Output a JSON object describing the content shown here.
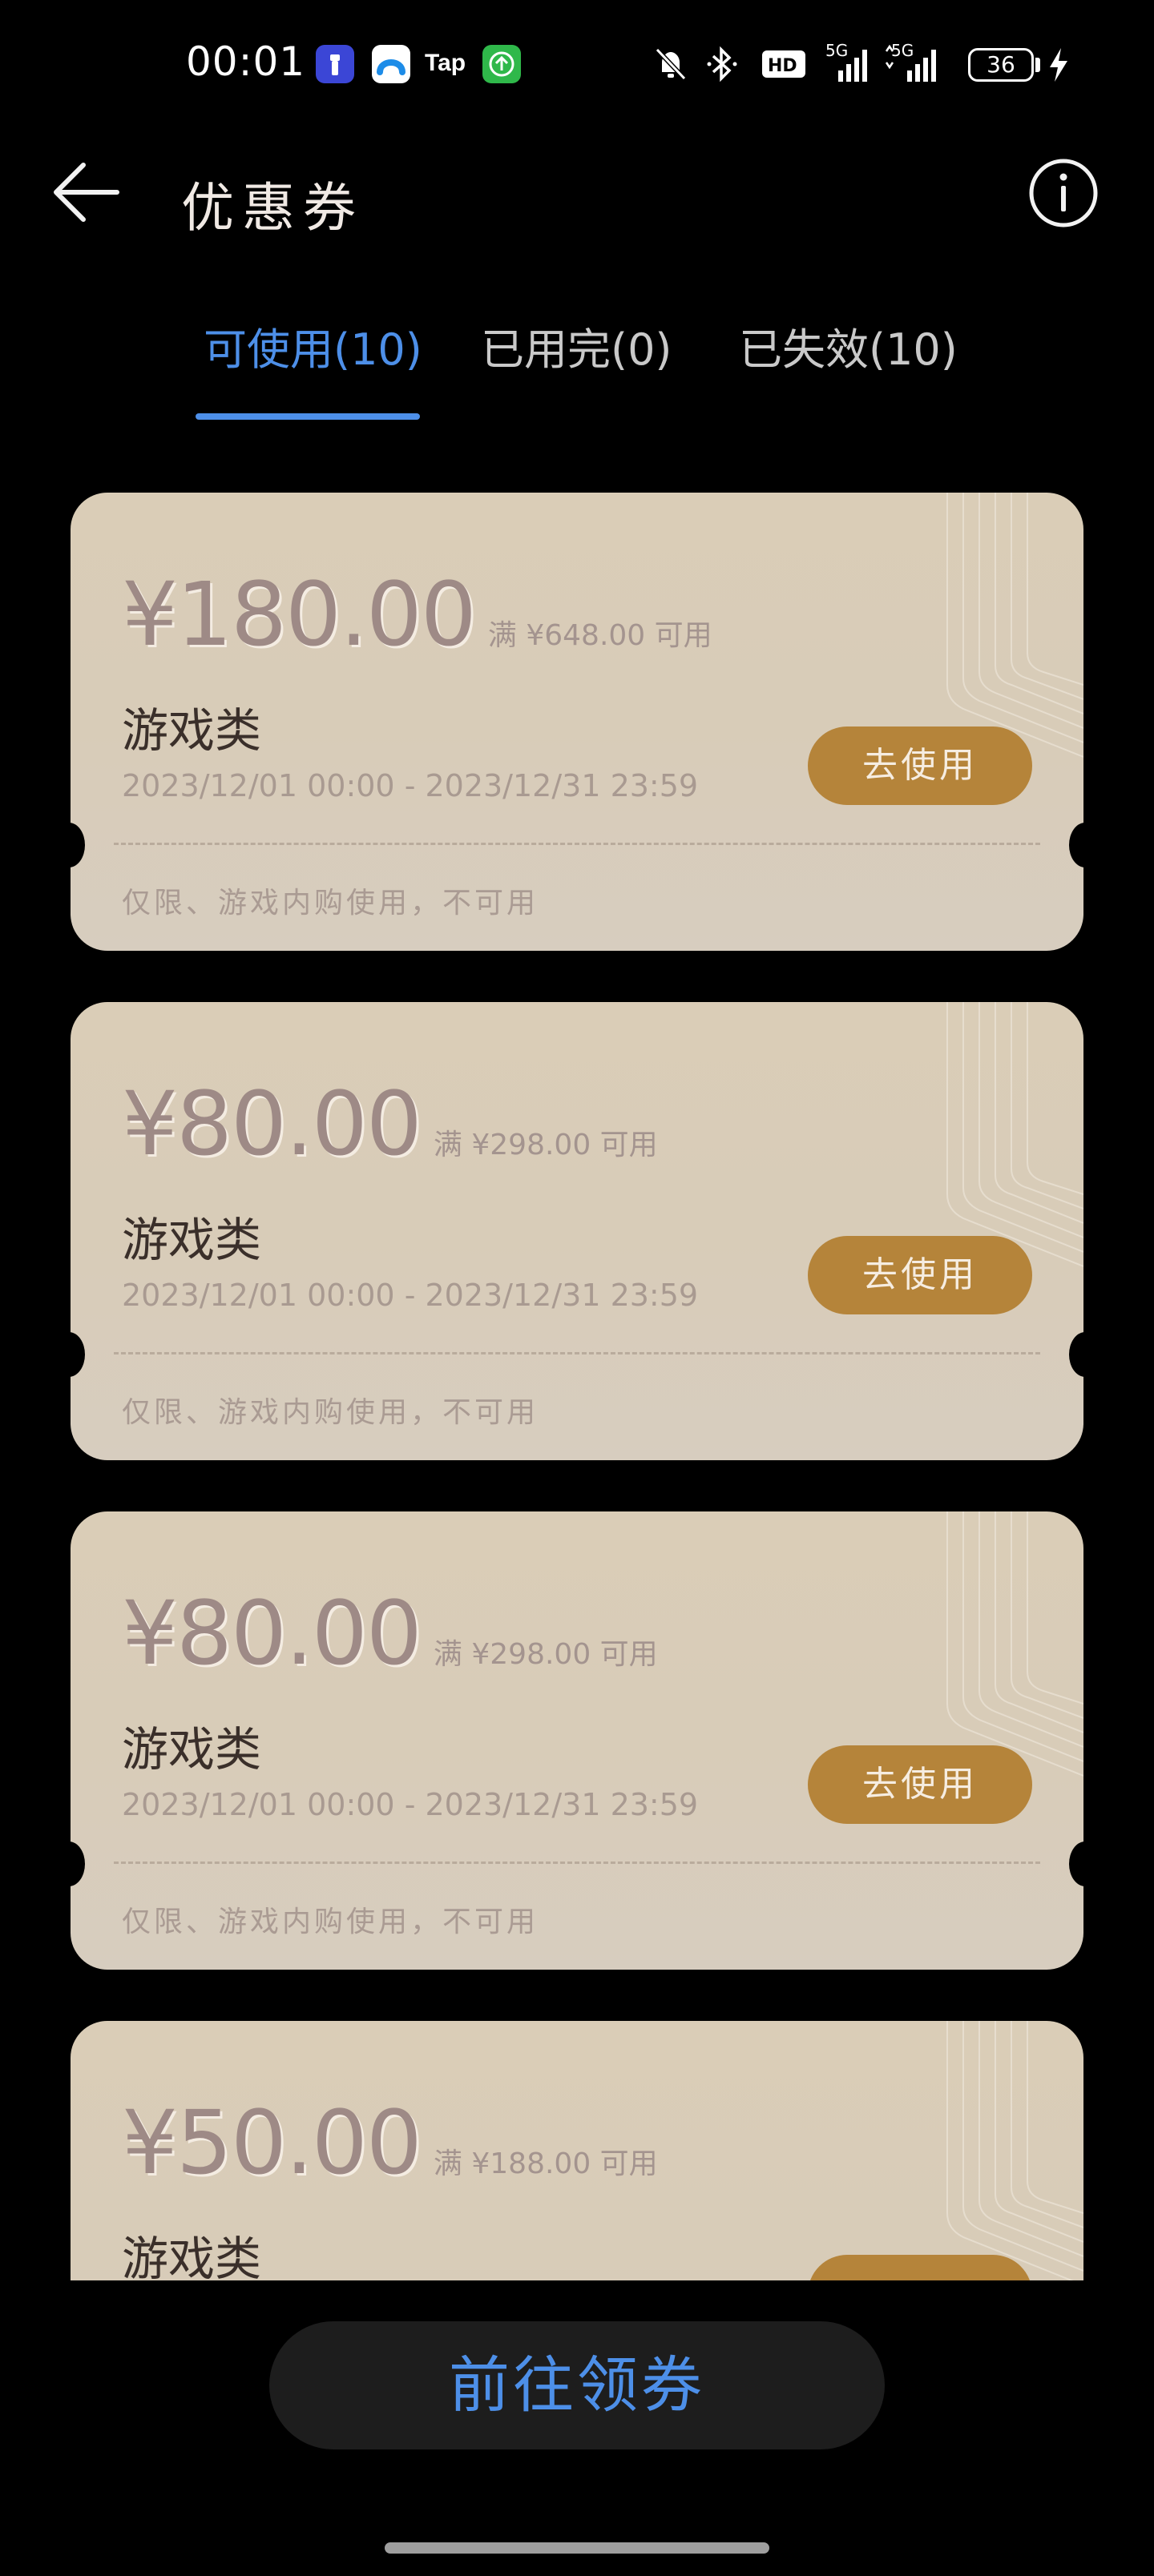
{
  "status_bar": {
    "time": "00:01",
    "tap_label": "Tap",
    "network_1": "5G",
    "network_2": "5G",
    "hd_label": "HD",
    "battery_level": "36",
    "icons": [
      "flashlight-app-icon",
      "blue-app-icon",
      "tap-app-icon",
      "green-upload-app-icon",
      "mute-icon",
      "bluetooth-icon",
      "hd-icon",
      "signal-icon",
      "signal-icon",
      "battery-icon",
      "charging-icon"
    ]
  },
  "header": {
    "title": "优惠券",
    "back_icon": "arrow-left-icon",
    "info_icon": "info-circle-icon"
  },
  "tabs": [
    {
      "label": "可使用(10)",
      "active": true
    },
    {
      "label": "已用完(0)",
      "active": false
    },
    {
      "label": "已失效(10)",
      "active": false
    }
  ],
  "coupons": [
    {
      "amount": "¥180.00",
      "threshold": "满 ¥648.00 可用",
      "category": "游戏类",
      "validity": "2023/12/01 00:00 - 2023/12/31 23:59",
      "button": "去使用",
      "restriction": "仅限、游戏内购使用，不可用"
    },
    {
      "amount": "¥80.00",
      "threshold": "满 ¥298.00 可用",
      "category": "游戏类",
      "validity": "2023/12/01 00:00 - 2023/12/31 23:59",
      "button": "去使用",
      "restriction": "仅限、游戏内购使用，不可用"
    },
    {
      "amount": "¥80.00",
      "threshold": "满 ¥298.00 可用",
      "category": "游戏类",
      "validity": "2023/12/01 00:00 - 2023/12/31 23:59",
      "button": "去使用",
      "restriction": "仅限、游戏内购使用，不可用"
    },
    {
      "amount": "¥50.00",
      "threshold": "满 ¥188.00 可用",
      "category": "游戏类",
      "validity": "",
      "button": "",
      "restriction": ""
    }
  ],
  "bottom": {
    "claim_button": "前往领券"
  },
  "colors": {
    "accent": "#4d8fe8",
    "coupon_bg": "#d9cdb9",
    "use_button_bg": "#b5843a",
    "background": "#000000"
  }
}
